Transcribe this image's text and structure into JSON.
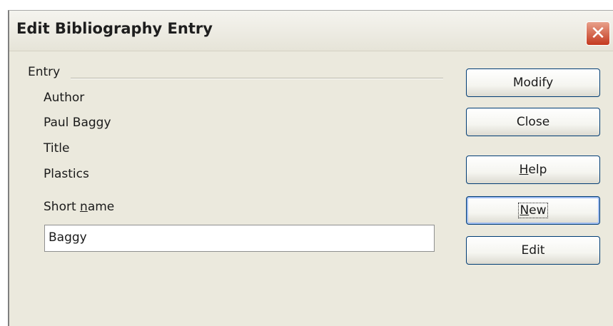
{
  "dialog": {
    "title": "Edit Bibliography Entry",
    "close_symbol": "✕"
  },
  "entry": {
    "frame_label": "Entry",
    "author_label": "Author",
    "author_value": "Paul Baggy",
    "title_label": "Title",
    "title_value": "Plastics",
    "short_name_label_pre": "Short ",
    "short_name_label_mnemonic": "n",
    "short_name_label_post": "ame",
    "short_name_value": "Baggy"
  },
  "buttons": {
    "modify": "Modify",
    "close": "Close",
    "help_mnemonic": "H",
    "help_rest": "elp",
    "new_mnemonic": "N",
    "new_rest": "ew",
    "edit": "Edit"
  },
  "colors": {
    "dialog_bg": "#ebe9dd",
    "close_button": "#c4391f",
    "button_border": "#003c74"
  }
}
